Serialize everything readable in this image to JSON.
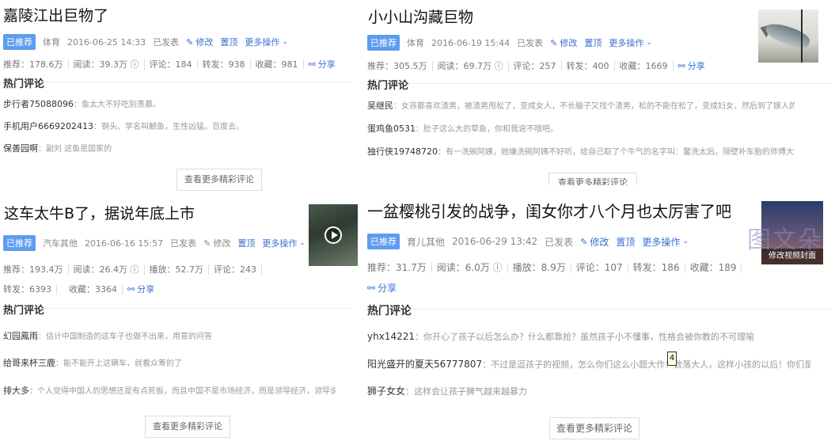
{
  "cards": [
    {
      "title": "嘉陵江出巨物了",
      "badge": "已推荐",
      "category": "体育",
      "date": "2016-06-25 14:33",
      "status": "已发表",
      "edit": "修改",
      "pin": "置顶",
      "more_ops": "更多操作",
      "stats": [
        "推荐：178.6万",
        "阅读：39.3万",
        "评论：184",
        "转发：938",
        "收藏：981"
      ],
      "share": "分享",
      "hot_label": "热门评论",
      "comments": [
        {
          "user": "步行者75088096",
          "text": "：鱼太大不好吃别羡慕。"
        },
        {
          "user": "手机用户6669202413",
          "text": "：钢头、学名叫鳡鱼，生性凶猛。百度去。"
        },
        {
          "user": "保善园啊",
          "text": "：副刘 这鱼是国家的"
        }
      ],
      "more_btn": "查看更多精彩评论"
    },
    {
      "title": "小小山沟藏巨物",
      "badge": "已推荐",
      "category": "体育",
      "date": "2016-06-19 15:44",
      "status": "已发表",
      "edit": "修改",
      "pin": "置顶",
      "more_ops": "更多操作",
      "stats": [
        "推荐：305.5万",
        "阅读：69.7万",
        "评论：257",
        "转发：400",
        "收藏：1669"
      ],
      "share": "分享",
      "hot_label": "热门评论",
      "comments": [
        {
          "user": "吴继民",
          "text": "：女孩都喜欢渣男，被渣男甩松了，变成女人，不长脑子又找个渣男，松的不能在松了，变成妇女，然后到了嫁人的年龄…"
        },
        {
          "user": "蛋鸡鱼0531",
          "text": "：肚子这么大的草鱼，你和我说不哦吧。"
        },
        {
          "user": "独行侠19748720",
          "text": "：有一洗碗阿姨，她嫌洗碗阿姨不好听，给自己取了个牛气的名字叫：鳌洗太后。隔壁补车胎的师傅大受启发…"
        }
      ],
      "more_btn": "查看更多精彩评论"
    },
    {
      "title": "这车太牛B了，据说年底上市",
      "badge": "已推荐",
      "category": "汽车其他",
      "date": "2016-06-16 15:57",
      "status": "已发表",
      "edit": "修改",
      "pin": "置顶",
      "more_ops": "更多操作",
      "stats": [
        "推荐：193.4万",
        "阅读：26.4万",
        "播放：52.7万",
        "评论：243",
        "转发：6393",
        "收藏：3364"
      ],
      "share": "分享",
      "hot_label": "热门评论",
      "comments": [
        {
          "user": "幻园鳳雨",
          "text": "：估计中国制造的这车子也做不出来，用意的问答"
        },
        {
          "user": "给哥来杯三鹿",
          "text": "：能不能开上这辆车，就看众筹的了"
        },
        {
          "user": "排大多",
          "text": "：个人觉得中国人的思想还是有点死板，而且中国不是市场经济，而是领导经济，领导说行，不行也行，领导说不行，行…"
        }
      ],
      "more_btn": "查看更多精彩评论"
    },
    {
      "title": "一盆樱桃引发的战争，闺女你才八个月也太厉害了吧",
      "badge": "已推荐",
      "category": "育儿其他",
      "date": "2016-06-29 13:42",
      "status": "已发表",
      "edit": "修改",
      "pin": "置顶",
      "more_ops": "更多操作",
      "stats": [
        "推荐：31.7万",
        "阅读：6.0万",
        "播放：8.9万",
        "评论：107",
        "转发：186",
        "收藏：189"
      ],
      "share": "分享",
      "hot_label": "热门评论",
      "thumb_caption": "修改视频封面",
      "comments": [
        {
          "user": "yhx14221",
          "text": "：你开心了孩子以后怎么办？什么都靠抢？虽然孩子小不懂事，性格会被你教的不可理喻"
        },
        {
          "user": "阳光盛开的夏天56777807",
          "text": "：不过是逗孩子的视频，怎么你们这么小题大作！数落大人，这样小孩的以后！你们是有多完美…"
        },
        {
          "user": "狮子女女",
          "text": "：这样会让孩子脾气越来越暴力"
        }
      ],
      "more_btn": "查看更多精彩评论"
    }
  ],
  "watermark": "图文朵",
  "marker": "4",
  "icons": {
    "edit": "pencil-icon",
    "share": "share-icon",
    "info": "info-icon",
    "chevron": "chevron-down-icon",
    "play": "play-icon"
  },
  "colors": {
    "accent": "#3a6fd0",
    "badge": "#5e9cf0"
  }
}
